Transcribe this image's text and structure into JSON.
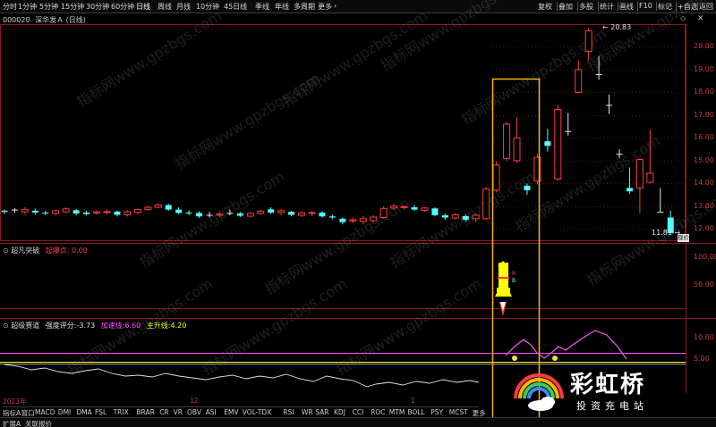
{
  "toolbar": {
    "timeframes": [
      "分时",
      "1分钟",
      "5分钟",
      "15分钟",
      "30分钟",
      "60分钟",
      "日线",
      "周线",
      "月线",
      "10分钟",
      "45日线",
      "季线",
      "年线",
      "多周期",
      "更多"
    ],
    "active_timeframe": "日线",
    "more_arrow": "›",
    "right_buttons": [
      "复权",
      "叠加",
      "多股",
      "统计",
      "画线",
      "F10",
      "标记",
      "+自选",
      "返回"
    ]
  },
  "stock": {
    "code": "000020",
    "name": "深华发Ａ",
    "period": "(日线)"
  },
  "price_axis": {
    "labels": [
      "20.00",
      "19.00",
      "18.00",
      "17.00",
      "16.00",
      "15.00",
      "14.00",
      "13.00",
      "12.00"
    ],
    "current_label": "现价"
  },
  "annotations": {
    "high": "20.83",
    "low": "11.81"
  },
  "panel2": {
    "title": "超凡突破",
    "sub_label": "起爆点:",
    "sub_value": "0.00",
    "axis": [
      "100.00",
      "50.00"
    ],
    "rocket_labels": [
      "R",
      "B"
    ]
  },
  "panel3": {
    "title": "超级赛道",
    "metric_label": "强度评分:",
    "metric_value": "-3.73",
    "line1_label": "加速线:",
    "line1_value": "6.60",
    "line2_label": "主升线:",
    "line2_value": "4.20",
    "axis": [
      "10.00",
      "5.00"
    ]
  },
  "date_axis": {
    "labels": [
      "2023年",
      "12",
      "1"
    ]
  },
  "indicators": [
    "指标A",
    "窗口",
    "MACD",
    "DMI",
    "DMA",
    "FSL",
    "TRIX",
    "BRAR",
    "CR",
    "VR",
    "OBV",
    "ASI",
    "EMV",
    "VOL-TDX",
    "RSI",
    "WR",
    "SAR",
    "KDJ",
    "CCI",
    "ROC",
    "MTM",
    "BOLL",
    "PSY",
    "MCST",
    "更多"
  ],
  "bottom_tabs": [
    "扩展A",
    "关联报价"
  ],
  "watermark": "指标网www.gpzbgs.com",
  "logo": {
    "name": "彩虹桥",
    "tagline": "投资充电站"
  },
  "colors": {
    "up": "#ff3c3c",
    "down": "#54ffff",
    "frame": "#ffb400",
    "pink": "#ff50ff",
    "yellow": "#ffff00",
    "axis_red": "#8b1a1a"
  },
  "chart_data": {
    "type": "candlestick",
    "ylim": [
      11.5,
      21.0
    ],
    "candles": [
      {
        "o": 12.8,
        "c": 12.75,
        "h": 12.85,
        "l": 12.65
      },
      {
        "o": 12.85,
        "c": 12.85,
        "h": 12.92,
        "l": 12.7
      },
      {
        "o": 12.75,
        "c": 12.85,
        "h": 12.95,
        "l": 12.65
      },
      {
        "o": 12.8,
        "c": 12.72,
        "h": 12.9,
        "l": 12.62
      },
      {
        "o": 12.72,
        "c": 12.7,
        "h": 12.8,
        "l": 12.6
      },
      {
        "o": 12.68,
        "c": 12.8,
        "h": 12.85,
        "l": 12.6
      },
      {
        "o": 12.75,
        "c": 12.88,
        "h": 12.95,
        "l": 12.7
      },
      {
        "o": 12.82,
        "c": 12.68,
        "h": 12.88,
        "l": 12.6
      },
      {
        "o": 12.72,
        "c": 12.65,
        "h": 12.8,
        "l": 12.58
      },
      {
        "o": 12.7,
        "c": 12.75,
        "h": 12.82,
        "l": 12.62
      },
      {
        "o": 12.72,
        "c": 12.76,
        "h": 12.85,
        "l": 12.65
      },
      {
        "o": 12.76,
        "c": 12.62,
        "h": 12.8,
        "l": 12.55
      },
      {
        "o": 12.62,
        "c": 12.75,
        "h": 12.82,
        "l": 12.55
      },
      {
        "o": 12.72,
        "c": 12.85,
        "h": 12.9,
        "l": 12.65
      },
      {
        "o": 12.85,
        "c": 12.95,
        "h": 13.02,
        "l": 12.8
      },
      {
        "o": 12.95,
        "c": 13.05,
        "h": 13.12,
        "l": 12.9
      },
      {
        "o": 13.05,
        "c": 12.85,
        "h": 13.1,
        "l": 12.8
      },
      {
        "o": 12.85,
        "c": 12.7,
        "h": 12.95,
        "l": 12.65
      },
      {
        "o": 12.72,
        "c": 12.68,
        "h": 12.82,
        "l": 12.6
      },
      {
        "o": 12.7,
        "c": 12.55,
        "h": 12.78,
        "l": 12.48
      },
      {
        "o": 12.62,
        "c": 12.6,
        "h": 12.75,
        "l": 12.5
      },
      {
        "o": 12.6,
        "c": 12.65,
        "h": 12.72,
        "l": 12.52
      },
      {
        "o": 12.7,
        "c": 12.7,
        "h": 12.85,
        "l": 12.6
      },
      {
        "o": 12.68,
        "c": 12.58,
        "h": 12.75,
        "l": 12.52
      },
      {
        "o": 12.56,
        "c": 12.68,
        "h": 12.75,
        "l": 12.5
      },
      {
        "o": 12.68,
        "c": 12.78,
        "h": 12.85,
        "l": 12.62
      },
      {
        "o": 12.86,
        "c": 12.72,
        "h": 12.95,
        "l": 12.66
      },
      {
        "o": 12.72,
        "c": 12.8,
        "h": 12.88,
        "l": 12.6
      },
      {
        "o": 12.75,
        "c": 12.62,
        "h": 12.8,
        "l": 12.55
      },
      {
        "o": 12.6,
        "c": 12.7,
        "h": 12.78,
        "l": 12.52
      },
      {
        "o": 12.7,
        "c": 12.72,
        "h": 12.8,
        "l": 12.58
      },
      {
        "o": 12.72,
        "c": 12.55,
        "h": 12.78,
        "l": 12.5
      },
      {
        "o": 12.55,
        "c": 12.5,
        "h": 12.62,
        "l": 12.42
      },
      {
        "o": 12.45,
        "c": 12.3,
        "h": 12.5,
        "l": 12.2
      },
      {
        "o": 12.35,
        "c": 12.4,
        "h": 12.5,
        "l": 12.25
      },
      {
        "o": 12.33,
        "c": 12.45,
        "h": 12.58,
        "l": 12.2
      },
      {
        "o": 12.36,
        "c": 12.52,
        "h": 12.6,
        "l": 12.3
      },
      {
        "o": 12.5,
        "c": 12.9,
        "h": 13.0,
        "l": 12.45
      },
      {
        "o": 12.92,
        "c": 13.0,
        "h": 13.1,
        "l": 12.85
      },
      {
        "o": 12.95,
        "c": 12.98,
        "h": 13.02,
        "l": 12.85
      },
      {
        "o": 12.95,
        "c": 12.85,
        "h": 13.05,
        "l": 12.8
      },
      {
        "o": 12.82,
        "c": 12.92,
        "h": 12.95,
        "l": 12.75
      },
      {
        "o": 12.9,
        "c": 12.6,
        "h": 12.95,
        "l": 12.55
      },
      {
        "o": 12.6,
        "c": 12.5,
        "h": 12.68,
        "l": 12.4
      },
      {
        "o": 12.48,
        "c": 12.62,
        "h": 12.7,
        "l": 12.42
      },
      {
        "o": 12.56,
        "c": 12.4,
        "h": 12.65,
        "l": 12.32
      },
      {
        "o": 12.45,
        "c": 12.6,
        "h": 12.68,
        "l": 12.3
      },
      {
        "o": 12.45,
        "c": 13.75,
        "h": 13.85,
        "l": 12.4
      },
      {
        "o": 13.7,
        "c": 14.8,
        "h": 14.95,
        "l": 13.6
      },
      {
        "o": 15.1,
        "c": 16.6,
        "h": 16.7,
        "l": 15.0
      },
      {
        "o": 15.0,
        "c": 16.0,
        "h": 16.9,
        "l": 14.9
      },
      {
        "o": 13.9,
        "c": 13.7,
        "h": 14.0,
        "l": 13.5
      },
      {
        "o": 14.1,
        "c": 15.15,
        "h": 15.3,
        "l": 13.95
      },
      {
        "o": 15.85,
        "c": 15.65,
        "h": 16.4,
        "l": 15.4
      },
      {
        "o": 14.2,
        "c": 17.25,
        "h": 17.45,
        "l": 14.1
      },
      {
        "o": 16.3,
        "c": 16.3,
        "h": 17.1,
        "l": 16.1
      },
      {
        "o": 18.0,
        "c": 19.0,
        "h": 19.4,
        "l": 17.95
      },
      {
        "o": 19.8,
        "c": 20.7,
        "h": 20.83,
        "l": 19.4
      },
      {
        "o": 18.8,
        "c": 18.8,
        "h": 19.6,
        "l": 18.55
      },
      {
        "o": 17.45,
        "c": 17.45,
        "h": 17.9,
        "l": 17.05
      },
      {
        "o": 15.3,
        "c": 15.3,
        "h": 15.5,
        "l": 15.1
      },
      {
        "o": 13.8,
        "c": 13.65,
        "h": 14.7,
        "l": 13.55
      },
      {
        "o": 13.8,
        "c": 15.05,
        "h": 15.1,
        "l": 12.7
      },
      {
        "o": 14.05,
        "c": 14.45,
        "h": 16.35,
        "l": 14.0
      },
      {
        "o": 12.75,
        "c": 12.75,
        "h": 13.8,
        "l": 12.75
      },
      {
        "o": 12.5,
        "c": 11.81,
        "h": 12.8,
        "l": 11.81
      }
    ]
  }
}
